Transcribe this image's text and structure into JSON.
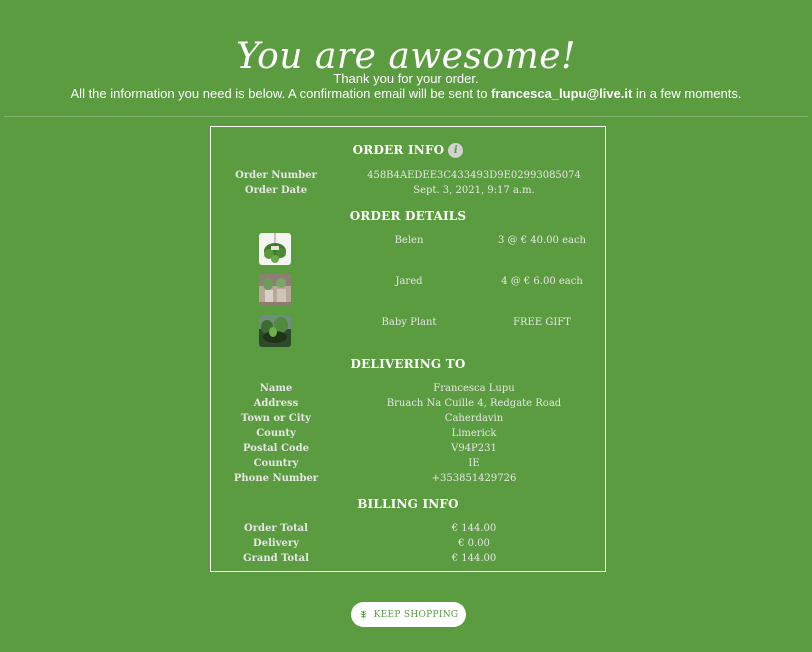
{
  "hero": {
    "title": "You are awesome!",
    "thanks_line": "Thank you for your order.",
    "info_prefix": "All the information you need is below. A confirmation email will be sent to ",
    "email": "francesca_lupu@live.it",
    "info_suffix": " in a few moments."
  },
  "order_info": {
    "title": "ORDER INFO",
    "info_icon": "i",
    "rows": [
      {
        "label": "Order Number",
        "value": "458B4AEDEE3C433493D9E02993085074"
      },
      {
        "label": "Order Date",
        "value": "Sept. 3, 2021, 9:17 a.m."
      }
    ]
  },
  "order_details": {
    "title": "ORDER DETAILS",
    "items": [
      {
        "name": "Belen",
        "qty": "3 @ € 40.00 each",
        "thumb": "hanging-plant-thumbnail"
      },
      {
        "name": "Jared",
        "qty": "4 @ € 6.00 each",
        "thumb": "potted-plant-thumbnail"
      },
      {
        "name": "Baby Plant",
        "qty": "FREE GIFT",
        "thumb": "seedling-thumbnail"
      }
    ]
  },
  "delivery": {
    "title": "DELIVERING TO",
    "rows": [
      {
        "label": "Name",
        "value": "Francesca Lupu"
      },
      {
        "label": "Address",
        "value": "Bruach Na Cuille 4, Redgate Road"
      },
      {
        "label": "Town or City",
        "value": "Caherdavin"
      },
      {
        "label": "County",
        "value": "Limerick"
      },
      {
        "label": "Postal Code",
        "value": "V94P231"
      },
      {
        "label": "Country",
        "value": "IE"
      },
      {
        "label": "Phone Number",
        "value": "+353851429726"
      }
    ]
  },
  "billing": {
    "title": "BILLING INFO",
    "rows": [
      {
        "label": "Order Total",
        "value": "€ 144.00"
      },
      {
        "label": "Delivery",
        "value": "€ 0.00"
      },
      {
        "label": "Grand Total",
        "value": "€ 144.00"
      }
    ]
  },
  "actions": {
    "keep_shopping_label": "KEEP SHOPPING",
    "keep_shopping_icon": "leaf-icon"
  },
  "colors": {
    "background": "#5b9c40",
    "text": "#ffffff",
    "button_bg": "#ffffff",
    "button_text": "#5b9c40"
  }
}
